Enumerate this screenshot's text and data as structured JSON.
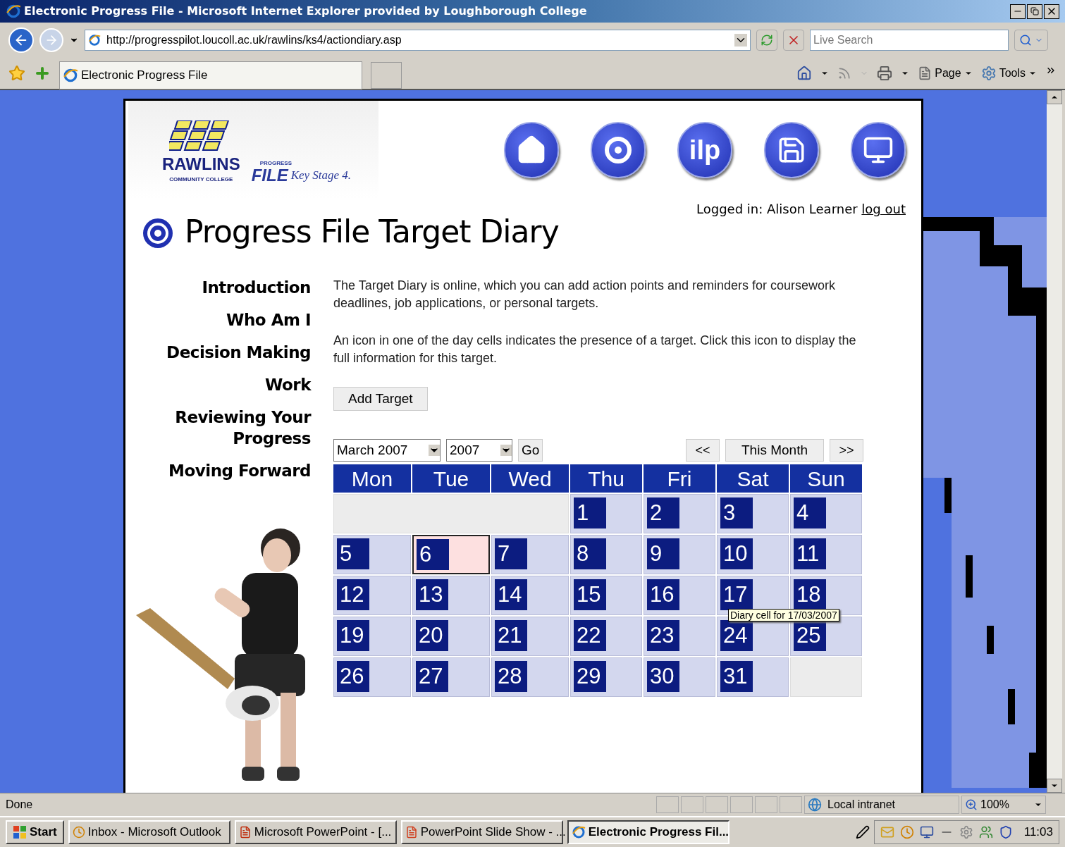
{
  "window": {
    "title": "Electronic Progress File - Microsoft Internet Explorer provided by Loughborough College"
  },
  "address_bar": {
    "url": "http://progresspilot.loucoll.ac.uk/rawlins/ks4/actiondiary.asp",
    "search_placeholder": "Live Search"
  },
  "tabs": [
    {
      "label": "Electronic Progress File",
      "selected": true
    }
  ],
  "command_bar": [
    "Page",
    "Tools"
  ],
  "logo": {
    "name": "RAWLINS",
    "subtitle": "COMMUNITY COLLEGE",
    "small": "PROGRESS",
    "file": "FILE",
    "stage": "Key Stage 4."
  },
  "nav_buttons": [
    {
      "kind": "home"
    },
    {
      "kind": "target"
    },
    {
      "kind": "text",
      "label": "ilp"
    },
    {
      "kind": "save"
    },
    {
      "kind": "computer"
    }
  ],
  "login": {
    "text": "Logged in: Alison Learner",
    "link": "log out"
  },
  "heading": "Progress File Target Diary",
  "sidebar": [
    "Introduction",
    "Who Am I",
    "Decision Making",
    "Work",
    "Reviewing Your Progress",
    "Moving Forward"
  ],
  "paragraphs": [
    "The Target Diary is online, which you can add action points and reminders for coursework deadlines, job applications, or personal targets.",
    "An icon in one of the day cells indicates the presence of a target. Click this icon to display the full information for this target."
  ],
  "add_button": "Add Target",
  "month_select": "March 2007",
  "year_select": "2007",
  "go": "Go",
  "prev": "<<",
  "this_month": "This Month",
  "next": ">>",
  "weekdays": [
    "Mon",
    "Tue",
    "Wed",
    "Thu",
    "Fri",
    "Sat",
    "Sun"
  ],
  "weeks": [
    [
      {
        "kind": "blank"
      },
      {
        "kind": "blank"
      },
      {
        "kind": "blank"
      },
      {
        "kind": "day",
        "day": "1",
        "selected": false
      },
      {
        "kind": "day",
        "day": "2",
        "selected": false
      },
      {
        "kind": "day",
        "day": "3",
        "selected": false
      },
      {
        "kind": "day",
        "day": "4",
        "selected": false
      }
    ],
    [
      {
        "kind": "day",
        "day": "5",
        "selected": false
      },
      {
        "kind": "day",
        "day": "6",
        "selected": true
      },
      {
        "kind": "day",
        "day": "7",
        "selected": false
      },
      {
        "kind": "day",
        "day": "8",
        "selected": false
      },
      {
        "kind": "day",
        "day": "9",
        "selected": false
      },
      {
        "kind": "day",
        "day": "10",
        "selected": false
      },
      {
        "kind": "day",
        "day": "11",
        "selected": false
      }
    ],
    [
      {
        "kind": "day",
        "day": "12",
        "selected": false
      },
      {
        "kind": "day",
        "day": "13",
        "selected": false
      },
      {
        "kind": "day",
        "day": "14",
        "selected": false
      },
      {
        "kind": "day",
        "day": "15",
        "selected": false
      },
      {
        "kind": "day",
        "day": "16",
        "selected": false
      },
      {
        "kind": "day",
        "day": "17",
        "selected": false
      },
      {
        "kind": "day",
        "day": "18",
        "selected": false
      }
    ],
    [
      {
        "kind": "day",
        "day": "19",
        "selected": false
      },
      {
        "kind": "day",
        "day": "20",
        "selected": false
      },
      {
        "kind": "day",
        "day": "21",
        "selected": false
      },
      {
        "kind": "day",
        "day": "22",
        "selected": false
      },
      {
        "kind": "day",
        "day": "23",
        "selected": false
      },
      {
        "kind": "day",
        "day": "24",
        "selected": false
      },
      {
        "kind": "day",
        "day": "25",
        "selected": false
      }
    ],
    [
      {
        "kind": "day",
        "day": "26",
        "selected": false
      },
      {
        "kind": "day",
        "day": "27",
        "selected": false
      },
      {
        "kind": "day",
        "day": "28",
        "selected": false
      },
      {
        "kind": "day",
        "day": "29",
        "selected": false
      },
      {
        "kind": "day",
        "day": "30",
        "selected": false
      },
      {
        "kind": "day",
        "day": "31",
        "selected": false
      },
      {
        "kind": "blank"
      }
    ]
  ],
  "tooltip": "Diary cell for 17/03/2007",
  "status_bar": {
    "status": "Done",
    "zone": "Local intranet",
    "zoom": "100%"
  },
  "taskbar": {
    "start": "Start",
    "tasks": [
      {
        "label": "Inbox - Microsoft Outlook",
        "kind": "outlook",
        "selected": false
      },
      {
        "label": "Microsoft PowerPoint - [...",
        "kind": "powerpoint",
        "selected": false
      },
      {
        "label": "PowerPoint Slide Show - ...",
        "kind": "slideshow",
        "selected": false
      },
      {
        "label": "Electronic Progress Fil...",
        "kind": "ie",
        "selected": true
      }
    ],
    "clock": "11:03"
  }
}
